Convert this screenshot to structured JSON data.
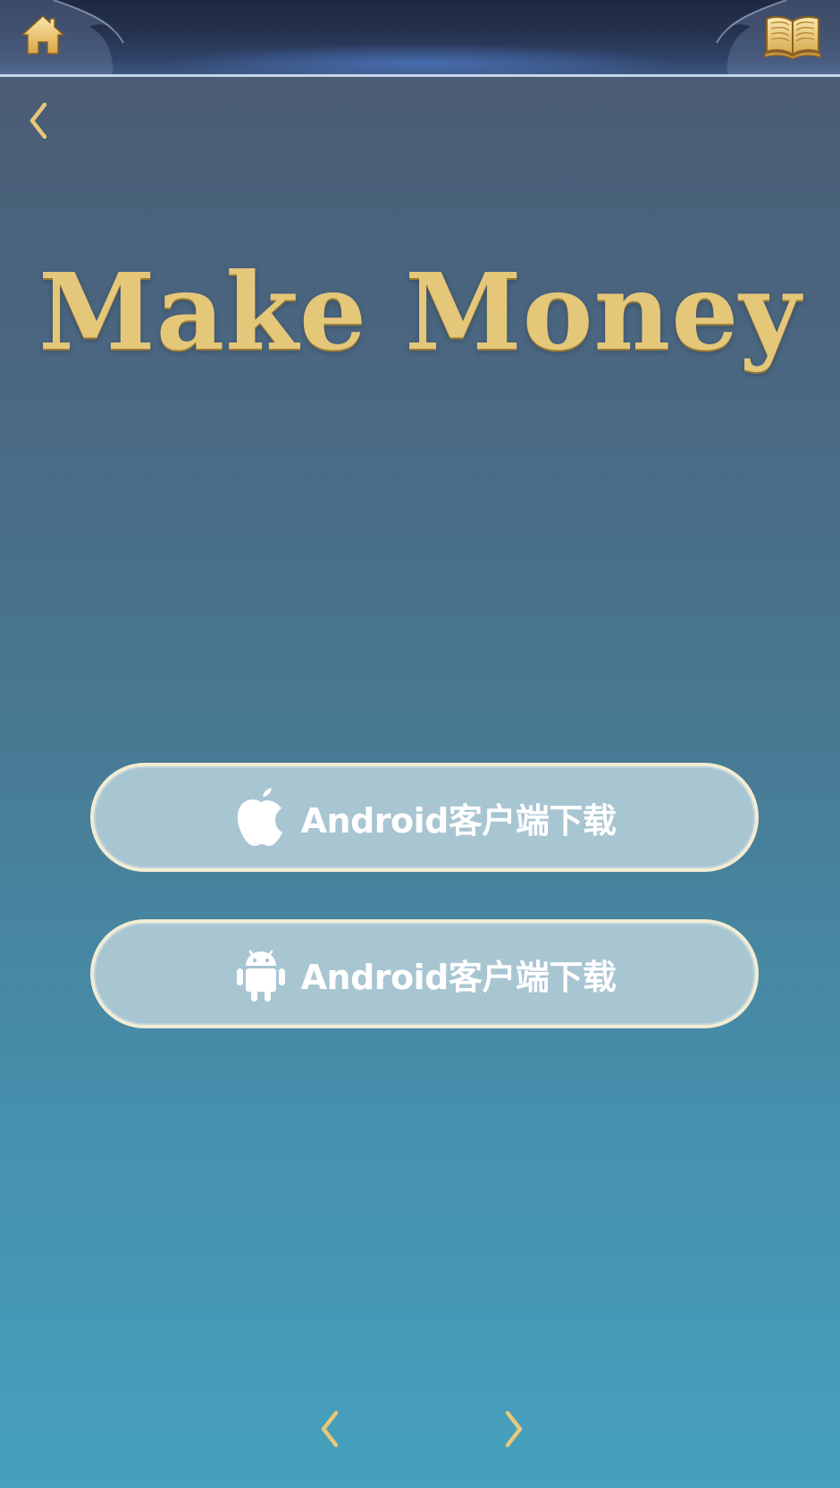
{
  "topbar": {
    "home_icon": "home-icon",
    "book_icon": "open-book-icon"
  },
  "nav": {
    "back_icon": "chevron-left-icon",
    "prev_icon": "chevron-left-icon",
    "next_icon": "chevron-right-icon"
  },
  "title": "Make Money",
  "downloads": [
    {
      "label": "Android客户端下载",
      "icon": "apple-icon"
    },
    {
      "label": "Android客户端下载",
      "icon": "android-icon"
    }
  ],
  "colors": {
    "gold": "#e5c77a",
    "button_fill": "#a8c5d2",
    "button_border": "#f2ecd2",
    "background_top": "#4b5a72",
    "background_bottom": "#46a1bd"
  }
}
